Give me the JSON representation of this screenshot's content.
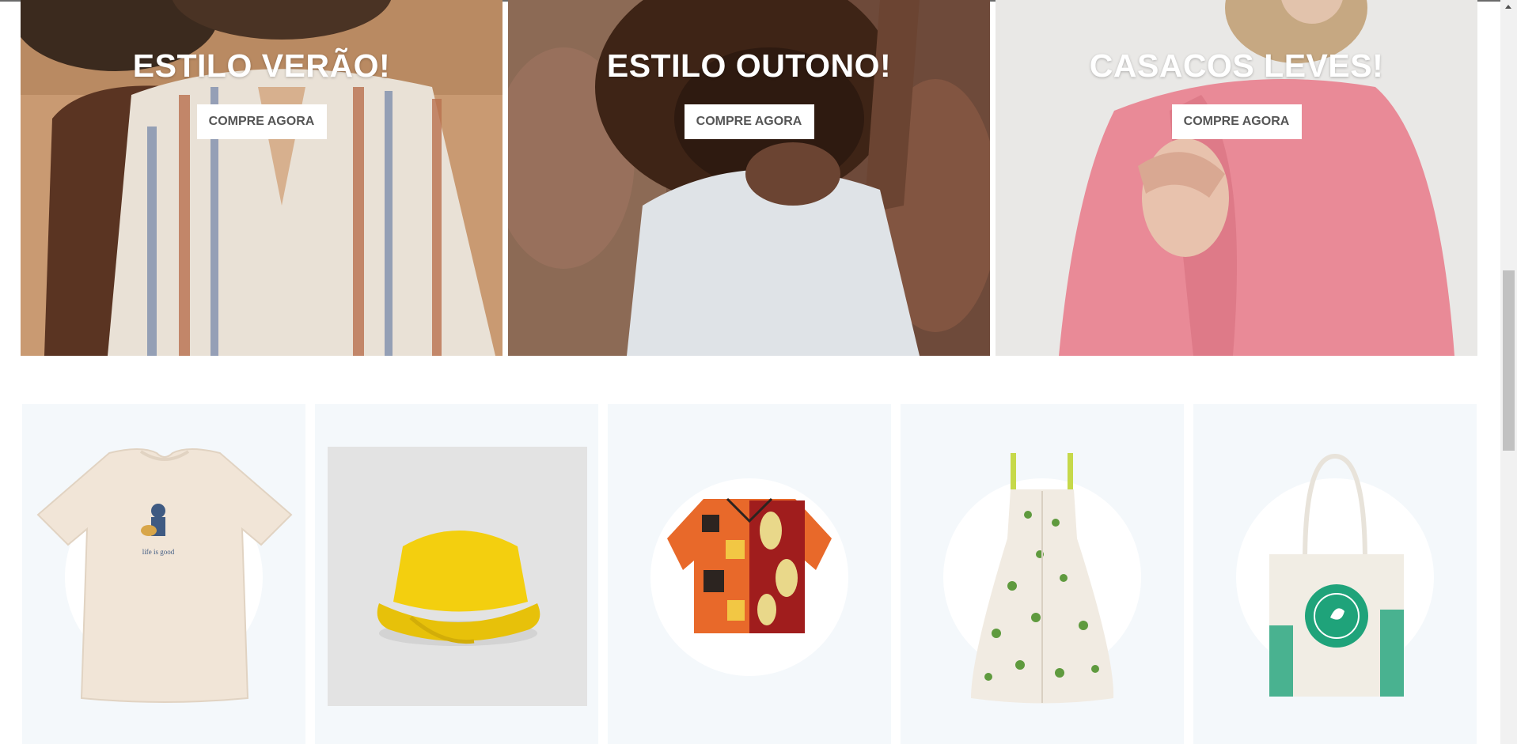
{
  "banners": [
    {
      "title": "ESTILO VERÃO!",
      "cta": "COMPRE AGORA"
    },
    {
      "title": "ESTILO OUTONO!",
      "cta": "COMPRE AGORA"
    },
    {
      "title": "CASACOS LEVES!",
      "cta": "COMPRE AGORA"
    }
  ],
  "products": [
    {
      "icon": "tshirt-image"
    },
    {
      "icon": "bucket-hat-image"
    },
    {
      "icon": "printed-shirt-image"
    },
    {
      "icon": "floral-dress-image"
    },
    {
      "icon": "tote-bag-image"
    }
  ],
  "colors": {
    "card_bg": "#f4f8fb",
    "cta_text": "#555555",
    "banner_title": "#ffffff"
  }
}
